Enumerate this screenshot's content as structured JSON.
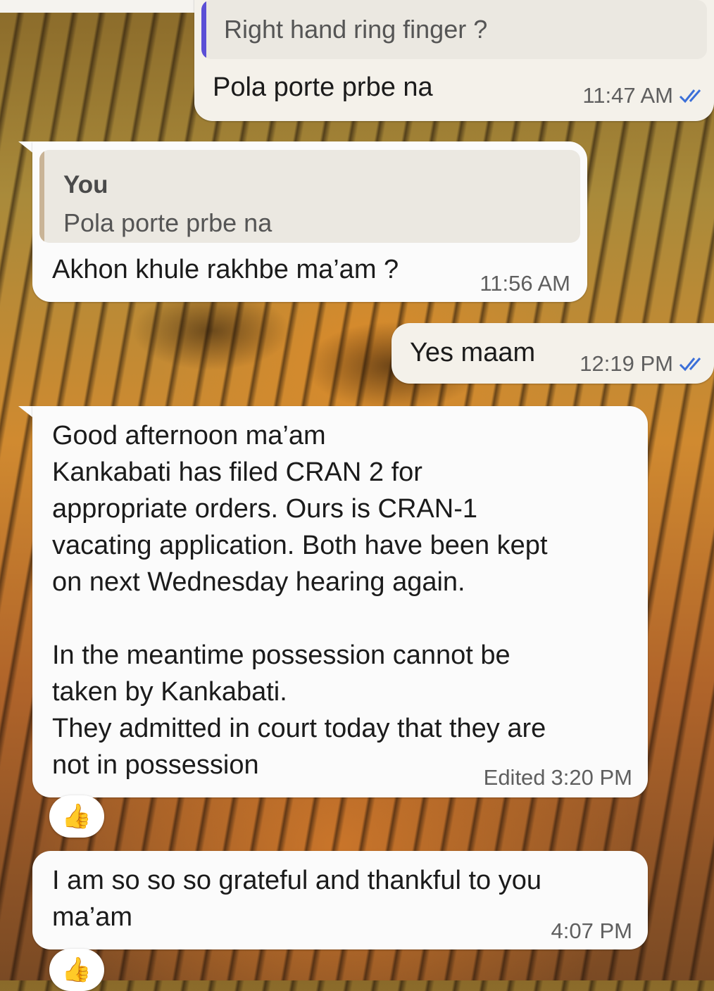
{
  "messages": [
    {
      "direction": "outgoing",
      "quoted_text": "Right hand ring finger ?",
      "text": "Pola porte prbe na",
      "time": "11:47 AM",
      "status": "read"
    },
    {
      "direction": "incoming",
      "quoted_author": "You",
      "quoted_text": "Pola porte prbe na",
      "text": "Akhon khule rakhbe ma’am ?",
      "time": "11:56 AM"
    },
    {
      "direction": "outgoing",
      "text": "Yes maam",
      "time": "12:19 PM",
      "status": "read"
    },
    {
      "direction": "incoming",
      "text": "Good afternoon ma’am\nKankabati has filed CRAN 2 for\nappropriate orders. Ours is CRAN-1\nvacating application. Both have been kept\non next Wednesday hearing again.\n\nIn the meantime possession cannot be\ntaken by Kankabati.\nThey admitted in court today that they are\nnot in possession",
      "edited_label": "Edited",
      "time": "3:20 PM",
      "reaction": "👍"
    },
    {
      "direction": "incoming",
      "text": "I am so so so grateful and thankful to you\nma’am",
      "time": "4:07 PM",
      "reaction": "👍"
    }
  ],
  "colors": {
    "outgoing_bubble": "#f4f1ea",
    "incoming_bubble": "#fbfbfb",
    "quote_bar_outgoing": "#5b4fd6",
    "quote_bar_incoming": "#c9b497",
    "read_tick": "#3b6fd8"
  },
  "icons": {
    "read_receipt": "double-check-icon",
    "reaction": "thumbs-up-icon"
  }
}
